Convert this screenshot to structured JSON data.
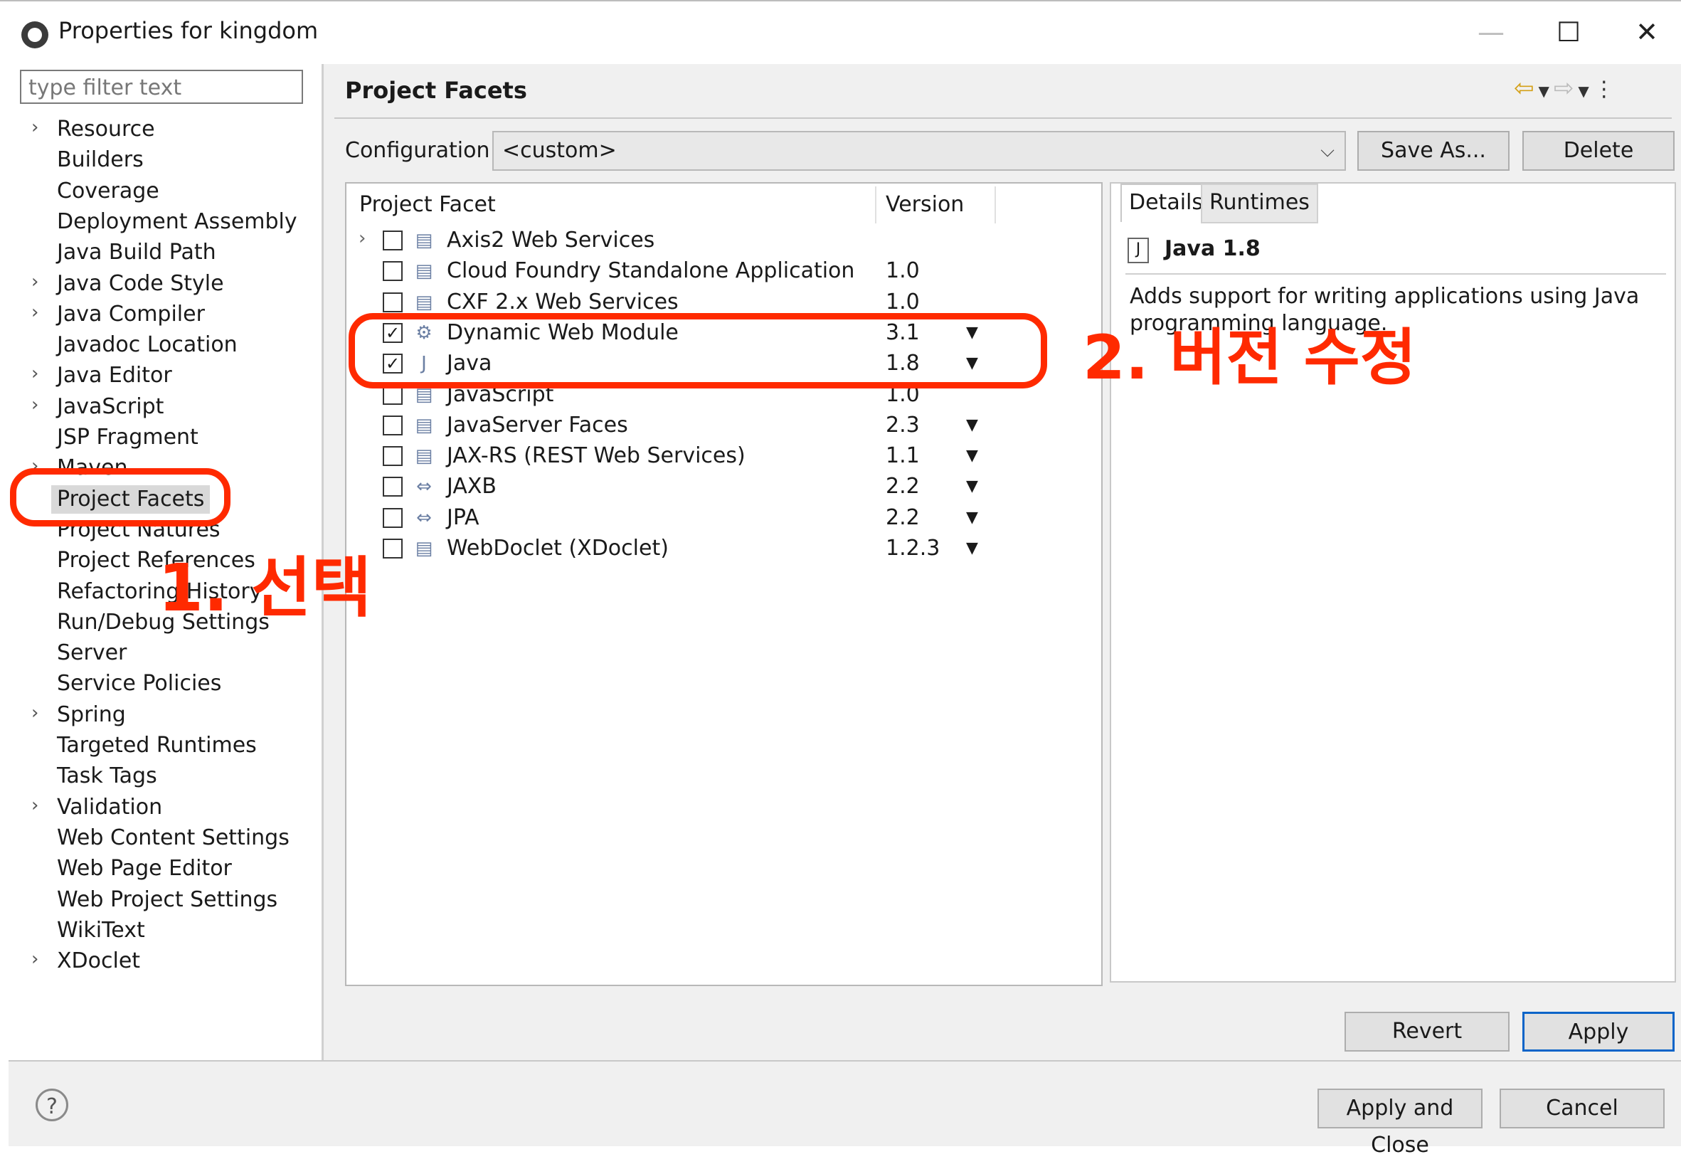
{
  "window": {
    "title": "Properties for kingdom",
    "minimize_glyph": "—",
    "maximize_glyph": "☐",
    "close_glyph": "✕"
  },
  "sidebar": {
    "filter_placeholder": "type filter text",
    "items": [
      {
        "label": "Resource",
        "expandable": true
      },
      {
        "label": "Builders",
        "expandable": false
      },
      {
        "label": "Coverage",
        "expandable": false
      },
      {
        "label": "Deployment Assembly",
        "expandable": false
      },
      {
        "label": "Java Build Path",
        "expandable": false
      },
      {
        "label": "Java Code Style",
        "expandable": true
      },
      {
        "label": "Java Compiler",
        "expandable": true
      },
      {
        "label": "Javadoc Location",
        "expandable": false
      },
      {
        "label": "Java Editor",
        "expandable": true
      },
      {
        "label": "JavaScript",
        "expandable": true
      },
      {
        "label": "JSP Fragment",
        "expandable": false
      },
      {
        "label": "Maven",
        "expandable": true
      },
      {
        "label": "Project Facets",
        "expandable": false,
        "selected": true
      },
      {
        "label": "Project Natures",
        "expandable": false
      },
      {
        "label": "Project References",
        "expandable": false
      },
      {
        "label": "Refactoring History",
        "expandable": false
      },
      {
        "label": "Run/Debug Settings",
        "expandable": false
      },
      {
        "label": "Server",
        "expandable": false
      },
      {
        "label": "Service Policies",
        "expandable": false
      },
      {
        "label": "Spring",
        "expandable": true
      },
      {
        "label": "Targeted Runtimes",
        "expandable": false
      },
      {
        "label": "Task Tags",
        "expandable": false
      },
      {
        "label": "Validation",
        "expandable": true
      },
      {
        "label": "Web Content Settings",
        "expandable": false
      },
      {
        "label": "Web Page Editor",
        "expandable": false
      },
      {
        "label": "Web Project Settings",
        "expandable": false
      },
      {
        "label": "WikiText",
        "expandable": false
      },
      {
        "label": "XDoclet",
        "expandable": true
      }
    ]
  },
  "main": {
    "title": "Project Facets",
    "configuration_label": "Configuration:",
    "configuration_value": "<custom>",
    "save_as_label": "Save As...",
    "delete_label": "Delete",
    "col_facet": "Project Facet",
    "col_version": "Version",
    "facets": [
      {
        "name": "Axis2 Web Services",
        "version": "",
        "checked": false,
        "expandable": true,
        "dropdown": false,
        "icon": "document-icon"
      },
      {
        "name": "Cloud Foundry Standalone Application",
        "version": "1.0",
        "checked": false,
        "expandable": false,
        "dropdown": false,
        "icon": "document-icon"
      },
      {
        "name": "CXF 2.x Web Services",
        "version": "1.0",
        "checked": false,
        "expandable": false,
        "dropdown": false,
        "icon": "document-icon"
      },
      {
        "name": "Dynamic Web Module",
        "version": "3.1",
        "checked": true,
        "expandable": false,
        "dropdown": true,
        "icon": "web-module-icon"
      },
      {
        "name": "Java",
        "version": "1.8",
        "checked": true,
        "expandable": false,
        "dropdown": true,
        "icon": "java-icon"
      },
      {
        "name": "JavaScript",
        "version": "1.0",
        "checked": false,
        "expandable": false,
        "dropdown": false,
        "icon": "document-icon"
      },
      {
        "name": "JavaServer Faces",
        "version": "2.3",
        "checked": false,
        "expandable": false,
        "dropdown": true,
        "icon": "document-icon"
      },
      {
        "name": "JAX-RS (REST Web Services)",
        "version": "1.1",
        "checked": false,
        "expandable": false,
        "dropdown": true,
        "icon": "document-icon"
      },
      {
        "name": "JAXB",
        "version": "2.2",
        "checked": false,
        "expandable": false,
        "dropdown": true,
        "icon": "bidirectional-arrow-icon"
      },
      {
        "name": "JPA",
        "version": "2.2",
        "checked": false,
        "expandable": false,
        "dropdown": true,
        "icon": "bidirectional-arrow-icon"
      },
      {
        "name": "WebDoclet (XDoclet)",
        "version": "1.2.3",
        "checked": false,
        "expandable": false,
        "dropdown": true,
        "icon": "document-icon"
      }
    ],
    "details_tab": "Details",
    "runtimes_tab": "Runtimes",
    "detail_title": "Java 1.8",
    "detail_description": "Adds support for writing applications using Java programming language.",
    "revert_label": "Revert",
    "apply_label": "Apply"
  },
  "footer": {
    "help_glyph": "?",
    "apply_close_label": "Apply and Close",
    "cancel_label": "Cancel"
  },
  "annotations": {
    "step1": "1. 선택",
    "step2": "2. 버전 수정",
    "color": "#ff2a00"
  }
}
